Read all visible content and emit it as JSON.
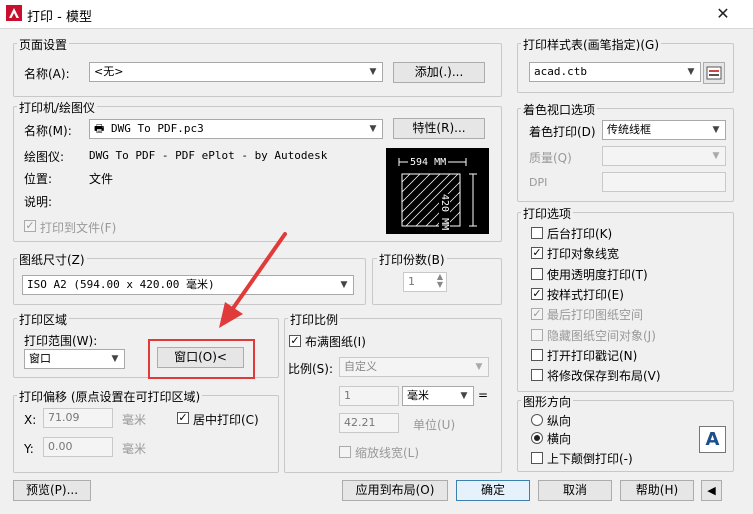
{
  "window": {
    "title": "打印 - 模型",
    "close": "✕"
  },
  "page_setup": {
    "group": "页面设置",
    "name_label": "名称(A):",
    "name_value": "<无>",
    "add_button": "添加(.)..."
  },
  "printer": {
    "group": "打印机/绘图仪",
    "name_label": "名称(M):",
    "name_value": "DWG To PDF.pc3",
    "properties_button": "特性(R)...",
    "plotter_label": "绘图仪:",
    "plotter_value": "DWG To PDF - PDF ePlot - by Autodesk",
    "location_label": "位置:",
    "location_value": "文件",
    "description_label": "说明:",
    "print_to_file": "打印到文件(F)",
    "preview_width": "594 MM",
    "preview_height": "420 MM"
  },
  "paper_size": {
    "group": "图纸尺寸(Z)",
    "value": "ISO A2 (594.00 x 420.00 毫米)"
  },
  "copies": {
    "group": "打印份数(B)",
    "value": "1"
  },
  "plot_area": {
    "group": "打印区域",
    "range_label": "打印范围(W):",
    "range_value": "窗口",
    "window_button": "窗口(O)<"
  },
  "plot_offset": {
    "group": "打印偏移 (原点设置在可打印区域)",
    "x_label": "X:",
    "x_value": "71.09",
    "x_unit": "毫米",
    "y_label": "Y:",
    "y_value": "0.00",
    "y_unit": "毫米",
    "center": "居中打印(C)"
  },
  "plot_scale": {
    "group": "打印比例",
    "fit": "布满图纸(I)",
    "scale_label": "比例(S):",
    "scale_value": "自定义",
    "val1": "1",
    "unit": "毫米",
    "eq": "=",
    "val2": "42.21",
    "unit2": "单位(U)",
    "lineweights": "缩放线宽(L)"
  },
  "style_table": {
    "group": "打印样式表(画笔指定)(G)",
    "value": "acad.ctb"
  },
  "shaded": {
    "group": "着色视口选项",
    "shade_label": "着色打印(D)",
    "shade_value": "传统线框",
    "quality_label": "质量(Q)",
    "dpi_label": "DPI"
  },
  "options": {
    "group": "打印选项",
    "items": [
      {
        "label": "后台打印(K)",
        "checked": "",
        "dis": false
      },
      {
        "label": "打印对象线宽",
        "checked": "✓",
        "dis": false
      },
      {
        "label": "使用透明度打印(T)",
        "checked": "",
        "dis": false
      },
      {
        "label": "按样式打印(E)",
        "checked": "✓",
        "dis": false
      },
      {
        "label": "最后打印图纸空间",
        "checked": "✓",
        "dis": true
      },
      {
        "label": "隐藏图纸空间对象(J)",
        "checked": "",
        "dis": true
      },
      {
        "label": "打开打印戳记(N)",
        "checked": "",
        "dis": false
      },
      {
        "label": "将修改保存到布局(V)",
        "checked": "",
        "dis": false
      }
    ]
  },
  "orientation": {
    "group": "图形方向",
    "portrait": "纵向",
    "landscape": "横向",
    "upside": "上下颠倒打印(-)",
    "icon_letter": "A"
  },
  "buttons": {
    "preview": "预览(P)...",
    "apply": "应用到布局(O)",
    "ok": "确定",
    "cancel": "取消",
    "help": "帮助(H)"
  }
}
